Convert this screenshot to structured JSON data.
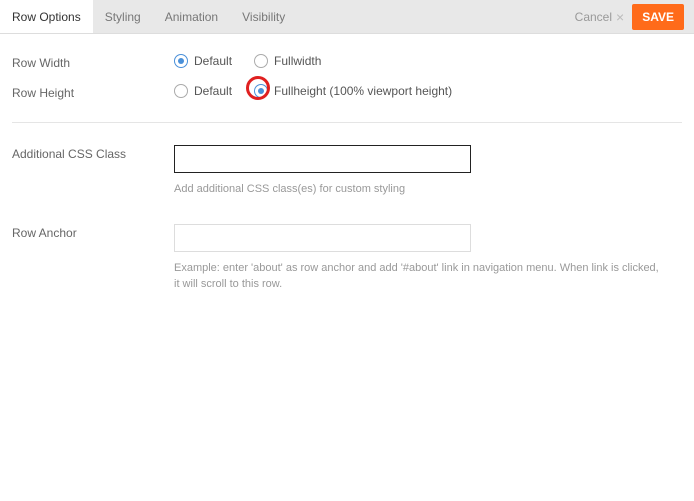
{
  "header": {
    "tabs": [
      {
        "label": "Row Options"
      },
      {
        "label": "Styling"
      },
      {
        "label": "Animation"
      },
      {
        "label": "Visibility"
      }
    ],
    "cancel_label": "Cancel",
    "save_label": "SAVE"
  },
  "fields": {
    "row_width": {
      "label": "Row Width",
      "option_default": "Default",
      "option_fullwidth": "Fullwidth"
    },
    "row_height": {
      "label": "Row Height",
      "option_default": "Default",
      "option_fullheight": "Fullheight (100% viewport height)"
    },
    "css_class": {
      "label": "Additional CSS Class",
      "value": "",
      "help": "Add additional CSS class(es) for custom styling"
    },
    "row_anchor": {
      "label": "Row Anchor",
      "value": "",
      "help": "Example: enter 'about' as row anchor and add '#about' link in navigation menu. When link is clicked, it will scroll to this row."
    }
  }
}
